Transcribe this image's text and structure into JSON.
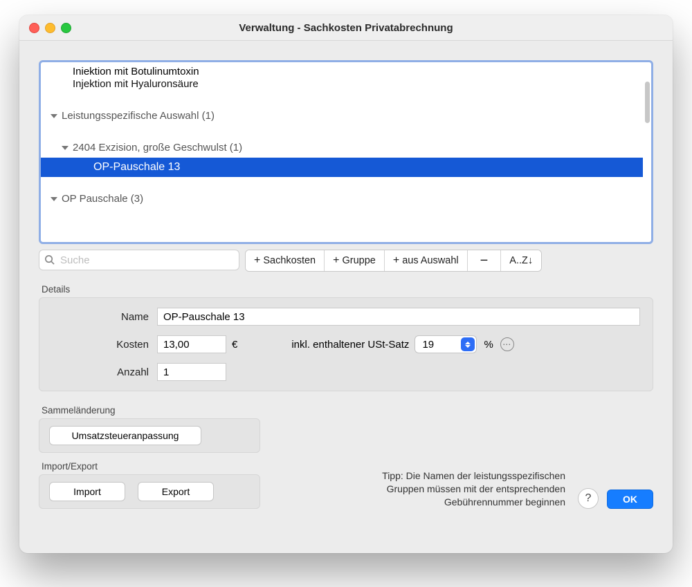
{
  "window": {
    "title": "Verwaltung - Sachkosten Privatabrechnung"
  },
  "list": {
    "items": [
      {
        "label": "Injektion mit Botulinumtoxin",
        "indent": 2,
        "type": "item"
      },
      {
        "label": "Injektion mit Hyaluronsäure",
        "indent": 2,
        "type": "item"
      },
      {
        "label": "Leistungsspezifische Auswahl (1)",
        "indent": 0,
        "type": "group",
        "expanded": true
      },
      {
        "label": "2404 Exzision, große Geschwulst (1)",
        "indent": 1,
        "type": "group",
        "expanded": true
      },
      {
        "label": "OP-Pauschale 13",
        "indent": 2,
        "type": "item",
        "selected": true
      },
      {
        "label": "OP Pauschale (3)",
        "indent": 0,
        "type": "group",
        "expanded": true
      }
    ]
  },
  "toolbar": {
    "search_placeholder": "Suche",
    "add_sachkosten": "Sachkosten",
    "add_gruppe": "Gruppe",
    "add_aus_auswahl": "aus Auswahl",
    "sort_az": "A..Z↓"
  },
  "details": {
    "heading": "Details",
    "name_label": "Name",
    "name_value": "OP-Pauschale 13",
    "kosten_label": "Kosten",
    "kosten_value": "13,00",
    "currency": "€",
    "ust_label": "inkl. enthaltener USt-Satz",
    "ust_value": "19",
    "percent": "%",
    "anzahl_label": "Anzahl",
    "anzahl_value": "1"
  },
  "sammel": {
    "heading": "Sammeländerung",
    "button": "Umsatzsteueranpassung"
  },
  "io": {
    "heading": "Import/Export",
    "import": "Import",
    "export": "Export"
  },
  "footer": {
    "tip_line1": "Tipp: Die Namen der leistungsspezifischen",
    "tip_line2": "Gruppen müssen mit der entsprechenden",
    "tip_line3": "Gebührennummer beginnen",
    "help": "?",
    "ok": "OK"
  }
}
